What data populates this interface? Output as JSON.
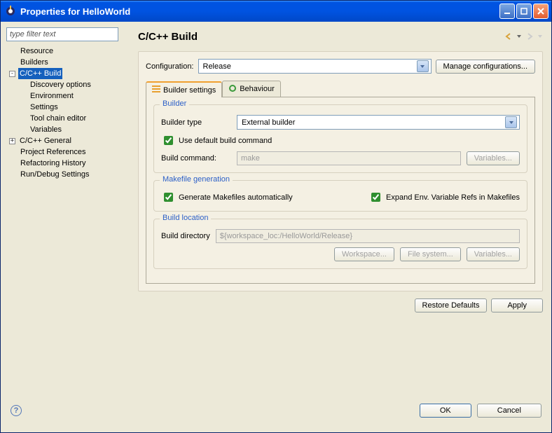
{
  "window": {
    "title": "Properties for HelloWorld"
  },
  "sidebar": {
    "filter_placeholder": "type filter text",
    "items": {
      "resource": "Resource",
      "builders": "Builders",
      "cpp_build": "C/C++ Build",
      "discovery": "Discovery options",
      "environment": "Environment",
      "settings": "Settings",
      "toolchain": "Tool chain editor",
      "variables": "Variables",
      "cpp_general": "C/C++ General",
      "proj_refs": "Project References",
      "refactor": "Refactoring History",
      "rundebug": "Run/Debug Settings"
    }
  },
  "page": {
    "title": "C/C++ Build"
  },
  "configuration": {
    "label": "Configuration:",
    "value": "Release",
    "manage_btn": "Manage configurations..."
  },
  "tabs": {
    "builder_settings": "Builder settings",
    "behaviour": "Behaviour"
  },
  "builder": {
    "group_title": "Builder",
    "type_label": "Builder type",
    "type_value": "External builder",
    "use_default_label": "Use default build command",
    "build_cmd_label": "Build command:",
    "build_cmd_value": "make",
    "variables_btn": "Variables..."
  },
  "makefile": {
    "group_title": "Makefile generation",
    "generate_label": "Generate Makefiles automatically",
    "expand_label": "Expand Env. Variable Refs in Makefiles"
  },
  "location": {
    "group_title": "Build location",
    "dir_label": "Build directory",
    "dir_value": "${workspace_loc:/HelloWorld/Release}",
    "workspace_btn": "Workspace...",
    "filesystem_btn": "File system...",
    "variables_btn": "Variables..."
  },
  "buttons": {
    "restore": "Restore Defaults",
    "apply": "Apply",
    "ok": "OK",
    "cancel": "Cancel"
  }
}
